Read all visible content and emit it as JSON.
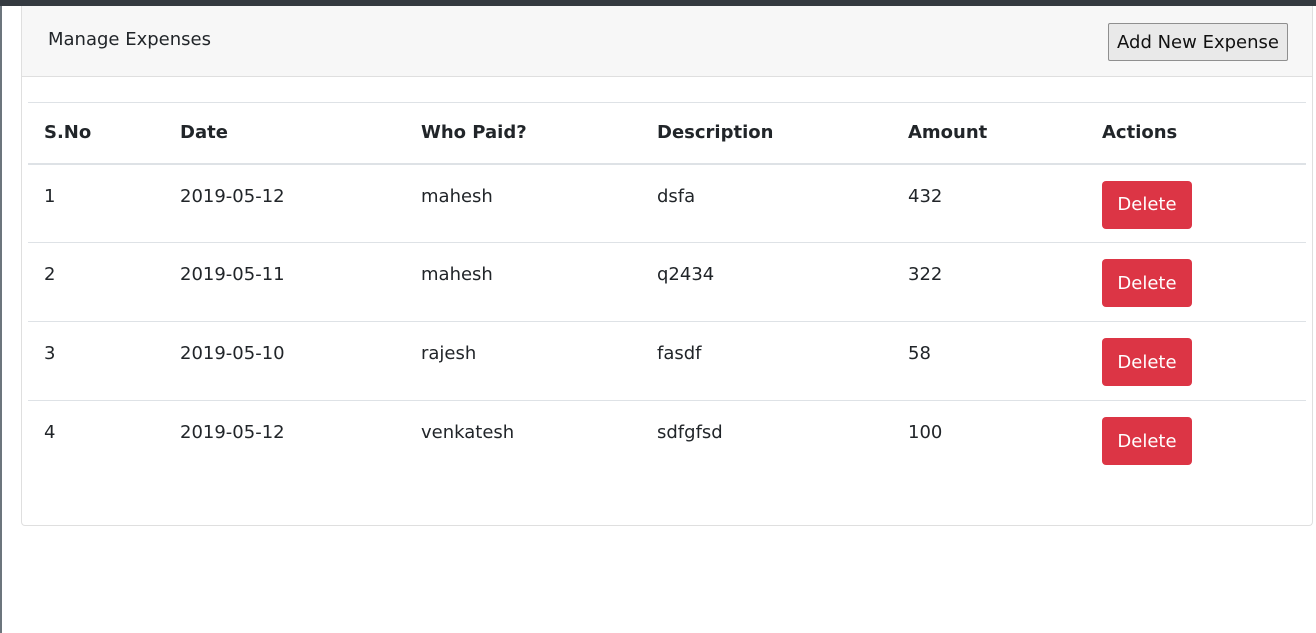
{
  "header": {
    "title": "Manage Expenses",
    "add_label": "Add New Expense"
  },
  "table": {
    "columns": [
      "S.No",
      "Date",
      "Who Paid?",
      "Description",
      "Amount",
      "Actions"
    ],
    "rows": [
      {
        "sno": "1",
        "date": "2019-05-12",
        "who": "mahesh",
        "description": "dsfa",
        "amount": "432",
        "action": "Delete"
      },
      {
        "sno": "2",
        "date": "2019-05-11",
        "who": "mahesh",
        "description": "q2434",
        "amount": "322",
        "action": "Delete"
      },
      {
        "sno": "3",
        "date": "2019-05-10",
        "who": "rajesh",
        "description": "fasdf",
        "amount": "58",
        "action": "Delete"
      },
      {
        "sno": "4",
        "date": "2019-05-12",
        "who": "venkatesh",
        "description": "sdfgfsd",
        "amount": "100",
        "action": "Delete"
      }
    ]
  },
  "colors": {
    "delete": "#dc3545",
    "header_bg": "#f7f7f7",
    "top_bar": "#343a40"
  }
}
